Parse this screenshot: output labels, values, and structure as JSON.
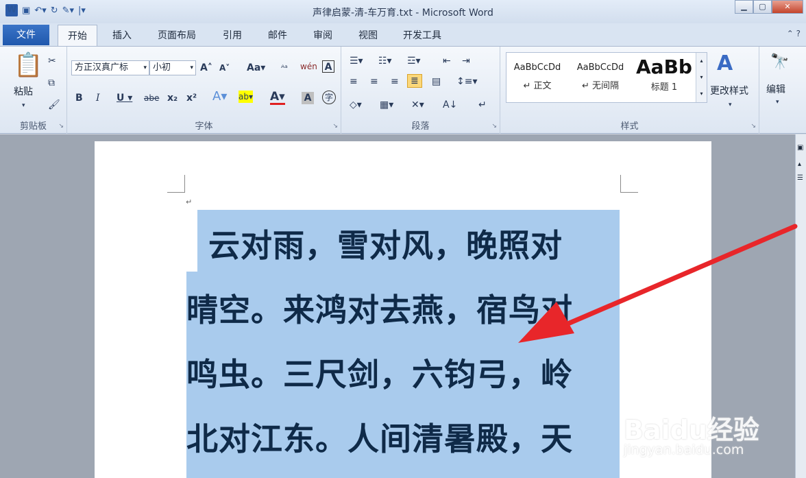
{
  "app": {
    "title": "声律启蒙-清-车万育.txt - Microsoft Word"
  },
  "tabs": [
    "文件",
    "开始",
    "插入",
    "页面布局",
    "引用",
    "邮件",
    "审阅",
    "视图",
    "开发工具"
  ],
  "ribbon": {
    "clipboard": {
      "label": "剪贴板",
      "paste": "粘贴"
    },
    "font": {
      "label": "字体",
      "font_name": "方正汉真广标",
      "font_size": "小初"
    },
    "paragraph": {
      "label": "段落"
    },
    "styles": {
      "label": "样式",
      "items": [
        {
          "preview": "AaBbCcDd",
          "name": "↵ 正文"
        },
        {
          "preview": "AaBbCcDd",
          "name": "↵ 无间隔"
        },
        {
          "preview": "AaBb",
          "name": "标题 1"
        }
      ],
      "change": "更改样式"
    },
    "editing": {
      "label": "编辑"
    }
  },
  "document": {
    "lines": [
      "云对雨，雪对风，晚照对",
      "晴空。来鸿对去燕，宿鸟对",
      "鸣虫。三尺剑，六钧弓，岭",
      "北对江东。人间清暑殿，天"
    ]
  },
  "watermark": {
    "brand": "Baidu经验",
    "url": "jingyan.baidu.com"
  },
  "colors": {
    "selection": "#a9cbed",
    "arrow": "#e8262a",
    "file_tab": "#2a66bf"
  }
}
